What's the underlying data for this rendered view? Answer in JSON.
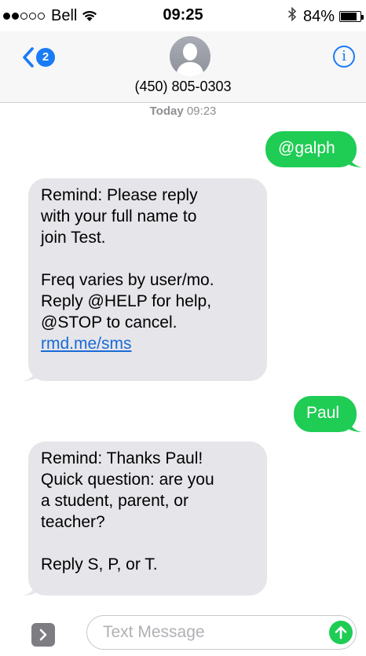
{
  "status_bar": {
    "carrier": "Bell",
    "time": "09:25",
    "battery_percent": "84%",
    "battery_level": 0.84,
    "signal_bars_filled": 2,
    "signal_bars_total": 5
  },
  "header": {
    "back_badge_count": "2",
    "contact_name": "(450) 805-0303",
    "info_glyph": "i"
  },
  "conversation": {
    "timestamp_day": "Today",
    "timestamp_time": "09:23",
    "messages": [
      {
        "direction": "outgoing",
        "lines": [
          "@galph"
        ]
      },
      {
        "direction": "incoming",
        "para1": [
          "Remind: Please reply",
          "with your full name to",
          "join Test."
        ],
        "para2": [
          "Freq varies by user/mo.",
          "Reply @HELP for help,",
          "@STOP to cancel."
        ],
        "link": "rmd.me/sms"
      },
      {
        "direction": "outgoing",
        "lines": [
          "Paul"
        ]
      },
      {
        "direction": "incoming",
        "para1": [
          "Remind: Thanks Paul!",
          "Quick question: are you",
          "a student, parent, or",
          "teacher?"
        ],
        "para2": [
          "Reply S, P, or T."
        ]
      }
    ]
  },
  "input_bar": {
    "placeholder": "Text Message",
    "value": ""
  },
  "colors": {
    "outgoing_bubble": "#1fcc54",
    "incoming_bubble": "#e5e5ea",
    "accent": "#1a7cf5"
  }
}
